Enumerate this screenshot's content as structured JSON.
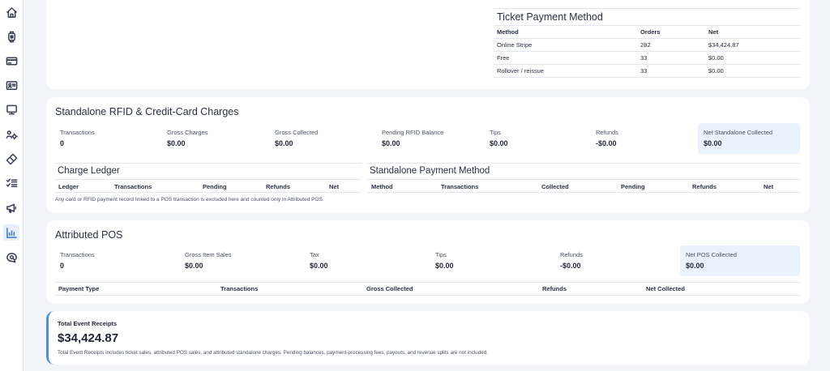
{
  "sidebar": {
    "items": [
      {
        "name": "home-icon",
        "active": false
      },
      {
        "name": "wristband-icon",
        "active": false
      },
      {
        "name": "credit-card-icon",
        "active": false
      },
      {
        "name": "id-card-icon",
        "active": false
      },
      {
        "name": "monitor-icon",
        "active": false
      },
      {
        "name": "users-gear-icon",
        "active": false
      },
      {
        "name": "ticket-icon",
        "active": false
      },
      {
        "name": "checklist-icon",
        "active": false
      },
      {
        "name": "megaphone-icon",
        "active": false
      },
      {
        "name": "bar-chart-icon",
        "active": true
      },
      {
        "name": "chat-search-icon",
        "active": false
      }
    ]
  },
  "ticket_payment": {
    "title": "Ticket Payment Method",
    "columns": [
      "Method",
      "Orders",
      "Net"
    ],
    "rows": [
      [
        "Online Stripe",
        "282",
        "$34,424.87"
      ],
      [
        "Free",
        "33",
        "$0.00"
      ],
      [
        "Rollover / reissue",
        "33",
        "$0.00"
      ]
    ]
  },
  "standalone": {
    "title": "Standalone RFID & Credit-Card Charges",
    "stats": [
      {
        "label": "Transactions",
        "value": "0"
      },
      {
        "label": "Gross Charges",
        "value": "$0.00"
      },
      {
        "label": "Gross Collected",
        "value": "$0.00"
      },
      {
        "label": "Pending RFID Balance",
        "value": "$0.00"
      },
      {
        "label": "Tips",
        "value": "$0.00"
      },
      {
        "label": "Refunds",
        "value": "-$0.00"
      },
      {
        "label": "Net Standalone Collected",
        "value": "$0.00"
      }
    ],
    "ledger": {
      "title": "Charge Ledger",
      "columns": [
        "Ledger",
        "Transactions",
        "Pending",
        "Refunds",
        "Net"
      ]
    },
    "payment_method": {
      "title": "Standalone Payment Method",
      "columns": [
        "Method",
        "Transactions",
        "Collected",
        "Pending",
        "Refunds",
        "Net"
      ]
    },
    "note": "Any card or RFID payment record linked to a POS transaction is excluded here and counted only in Attributed POS."
  },
  "pos": {
    "title": "Attributed POS",
    "stats": [
      {
        "label": "Transactions",
        "value": "0"
      },
      {
        "label": "Gross Item Sales",
        "value": "$0.00"
      },
      {
        "label": "Tax",
        "value": "$0.00"
      },
      {
        "label": "Tips",
        "value": "$0.00"
      },
      {
        "label": "Refunds",
        "value": "-$0.00"
      },
      {
        "label": "Net POS Collected",
        "value": "$0.00"
      }
    ],
    "columns": [
      "Payment Type",
      "Transactions",
      "Gross Collected",
      "Refunds",
      "Net Collected"
    ]
  },
  "total": {
    "label": "Total Event Receipts",
    "value": "$34,424.87",
    "note": "Total Event Receipts includes ticket sales, attributed POS sales, and attributed standalone charges. Pending balances, payment-processing fees, payouts, and revenue splits are not included."
  }
}
